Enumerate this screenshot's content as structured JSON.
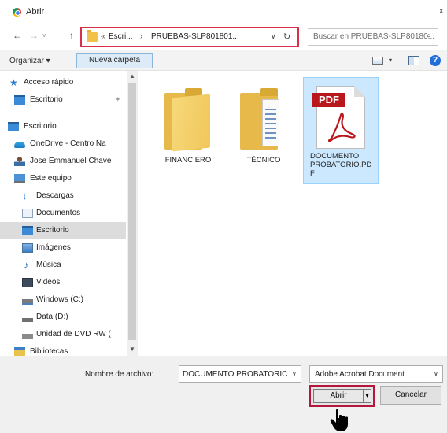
{
  "window": {
    "title": "Abrir",
    "close_glyph": "x"
  },
  "nav": {
    "back": "←",
    "forward": "→",
    "history": "˅",
    "up": "↑"
  },
  "address": {
    "prefix": "«",
    "segments": [
      "Escri...",
      "PRUEBAS-SLP801801..."
    ],
    "separator": "›",
    "dropdown": "∨",
    "refresh": "↻"
  },
  "search": {
    "placeholder": "Buscar en PRUEBAS-SLP80180..."
  },
  "toolbar": {
    "organize": "Organizar ▾",
    "new_folder": "Nueva carpeta",
    "view_dropdown": "▾",
    "help": "?"
  },
  "sidebar": {
    "items": [
      {
        "label": "Acceso rápido",
        "icon": "star-icon"
      },
      {
        "label": "Escritorio",
        "icon": "desktop-icon",
        "pinned": true
      },
      {
        "label": "Escritorio",
        "icon": "desktop-icon"
      },
      {
        "label": "OneDrive - Centro Na",
        "icon": "onedrive-icon"
      },
      {
        "label": "Jose Emmanuel Chave",
        "icon": "user-icon"
      },
      {
        "label": "Este equipo",
        "icon": "computer-icon"
      },
      {
        "label": "Descargas",
        "icon": "download-icon"
      },
      {
        "label": "Documentos",
        "icon": "documents-icon"
      },
      {
        "label": "Escritorio",
        "icon": "desktop-icon",
        "selected": true
      },
      {
        "label": "Imágenes",
        "icon": "pictures-icon"
      },
      {
        "label": "Música",
        "icon": "music-icon"
      },
      {
        "label": "Videos",
        "icon": "video-icon"
      },
      {
        "label": "Windows (C:)",
        "icon": "drive-icon"
      },
      {
        "label": "Data (D:)",
        "icon": "drive-icon"
      },
      {
        "label": "Unidad de DVD RW (",
        "icon": "dvd-icon"
      },
      {
        "label": "Bibliotecas",
        "icon": "library-icon"
      }
    ]
  },
  "files": [
    {
      "name": "FINANCIERO",
      "type": "folder"
    },
    {
      "name": "TÉCNICO",
      "type": "folder"
    },
    {
      "name_lines": [
        "DOCUMENTO",
        "PROBATORIO.PD",
        "F"
      ],
      "type": "pdf",
      "badge": "PDF",
      "selected": true
    }
  ],
  "footer": {
    "filename_label": "Nombre de archivo:",
    "filename_value": "DOCUMENTO PROBATORIC",
    "filetype_value": "Adobe Acrobat Document",
    "open_label": "Abrir",
    "open_split": "▾",
    "cancel_label": "Cancelar"
  },
  "colors": {
    "highlight_border": "#d9304a",
    "selection": "#cce8ff",
    "pdf_red": "#b8171b"
  }
}
